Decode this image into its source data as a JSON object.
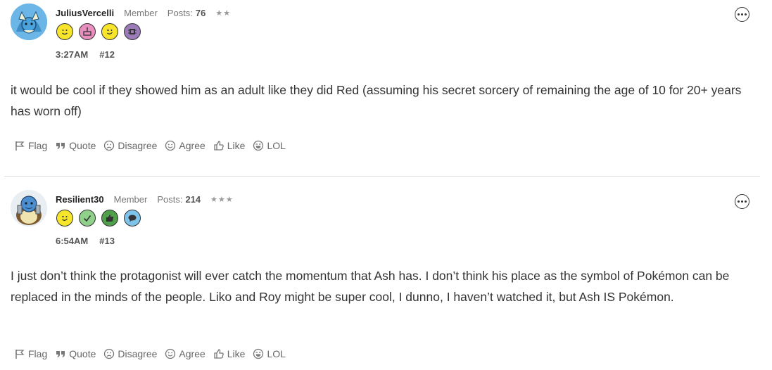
{
  "posts": [
    {
      "username": "JuliusVercelli",
      "role": "Member",
      "posts_label": "Posts:",
      "posts_count": "76",
      "stars": "★★",
      "time": "3:27AM",
      "number": "#12",
      "body": "it would be cool if they showed him as an adult like they did Red (assuming his secret sorcery of remaining the age of 10 for 20+ years has worn off)",
      "badges": [
        "smile-face-badge",
        "cake-badge",
        "wink-face-badge",
        "chip-badge"
      ]
    },
    {
      "username": "Resilient30",
      "role": "Member",
      "posts_label": "Posts:",
      "posts_count": "214",
      "stars": "★★★",
      "time": "6:54AM",
      "number": "#13",
      "body": "I just don’t think the protagonist will ever catch the momentum that Ash has. I don’t think his place as the symbol of Pokémon can be replaced in the minds of the people. Liko and Roy might be super cool, I dunno, I haven’t watched it, but Ash IS Pokémon.",
      "badges": [
        "wink-face-badge",
        "check-badge",
        "thumbs-up-badge",
        "speech-bubble-badge"
      ]
    }
  ],
  "actions": {
    "flag": "Flag",
    "quote": "Quote",
    "disagree": "Disagree",
    "agree": "Agree",
    "like": "Like",
    "lol": "LOL"
  },
  "colors": {
    "badge_yellow": "#f7e52b",
    "badge_pink": "#e88fbf",
    "badge_purple": "#9b7bb8",
    "badge_green": "#8fd18a",
    "badge_darkgreen": "#4fa04a",
    "badge_blue": "#7ec3ea"
  }
}
